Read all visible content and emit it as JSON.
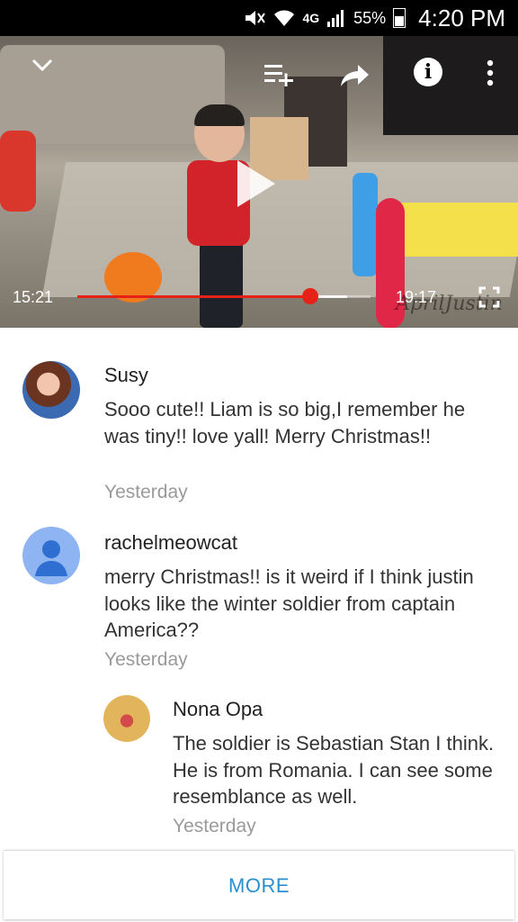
{
  "status_bar": {
    "lte": "4G",
    "battery": "55%",
    "time": "4:20 PM"
  },
  "player": {
    "current_time": "15:21",
    "duration": "19:17",
    "progress": 0.7957,
    "buffered": 0.919,
    "watermark": "AprilJustin",
    "icons": {
      "collapse": "chevron-down-icon",
      "queue": "add-to-queue-icon",
      "share": "share-icon",
      "info": "info-icon",
      "more": "more-vert-icon",
      "play": "play-icon",
      "fullscreen": "fullscreen-icon"
    }
  },
  "comments": [
    {
      "author": "Susy",
      "text": "Sooo cute!! Liam is so big,I remember he was tiny!! love yall! Merry Christmas!!",
      "time": "Yesterday",
      "avatar": "photo-avatar"
    },
    {
      "author": "rachelmeowcat",
      "text": "merry Christmas!! is it weird if I think justin looks like the winter soldier from captain America??",
      "time": "Yesterday",
      "avatar": "default-person-avatar",
      "avatar_color": "#8fb4f2",
      "replies": [
        {
          "author": "Nona Opa",
          "text": "The soldier is Sebastian Stan I think. He is from Romania. I can see some resemblance as well.",
          "time": "Yesterday",
          "avatar": "photo-avatar"
        }
      ]
    }
  ],
  "more_button": "MORE",
  "colors": {
    "accent": "#2a8fd0",
    "progress": "#e62117",
    "status_bar": "#000000"
  }
}
